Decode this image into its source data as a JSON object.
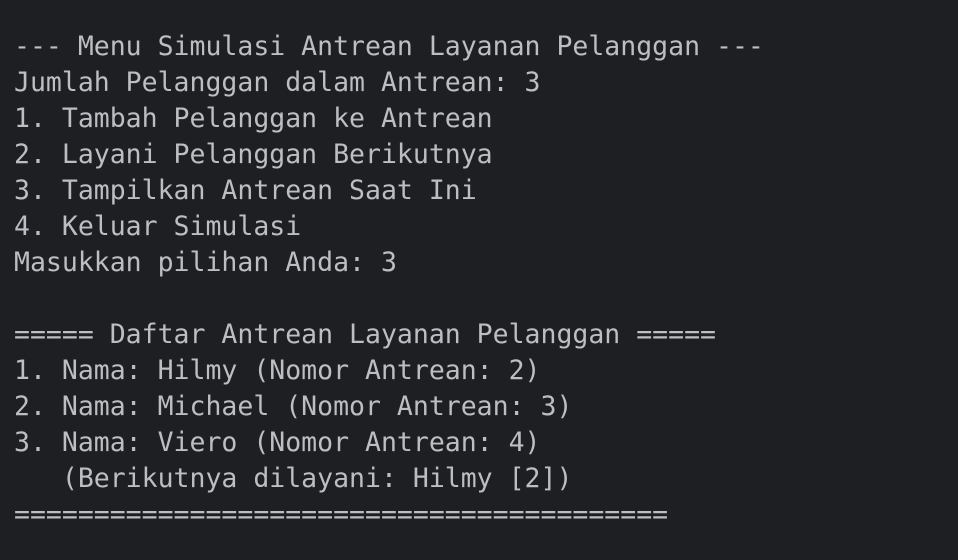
{
  "terminal": {
    "lines": [
      "--- Menu Simulasi Antrean Layanan Pelanggan ---",
      "Jumlah Pelanggan dalam Antrean: 3",
      "1. Tambah Pelanggan ke Antrean",
      "2. Layani Pelanggan Berikutnya",
      "3. Tampilkan Antrean Saat Ini",
      "4. Keluar Simulasi",
      "Masukkan pilihan Anda: 3",
      "",
      "===== Daftar Antrean Layanan Pelanggan =====",
      "1. Nama: Hilmy (Nomor Antrean: 2)",
      "2. Nama: Michael (Nomor Antrean: 3)",
      "3. Nama: Viero (Nomor Antrean: 4)",
      "   (Berikutnya dilayani: Hilmy [2])",
      "========================================="
    ]
  }
}
